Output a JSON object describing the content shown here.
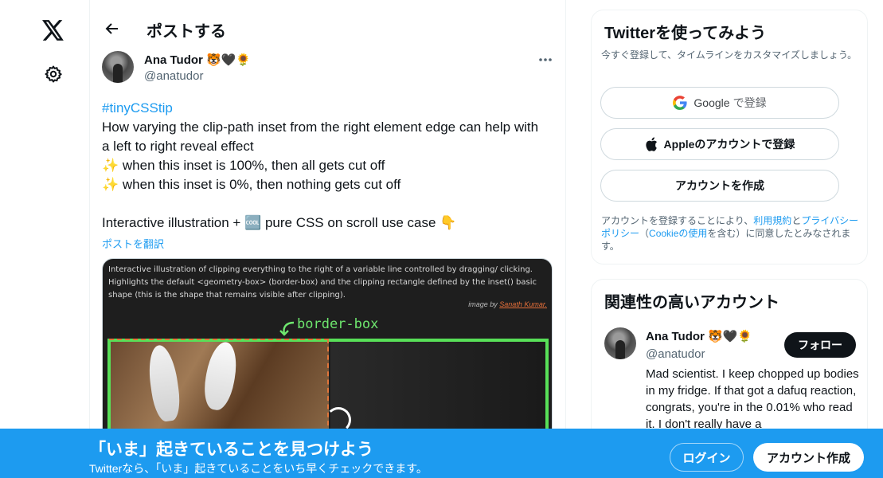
{
  "header": {
    "title": "ポストする"
  },
  "tweet": {
    "author_name": "Ana Tudor 🐯🖤🌻",
    "author_handle": "@anatudor",
    "hashtag": "#tinyCSStip",
    "lines": [
      "How varying the clip-path inset from the right element edge can help with",
      "a left to right reveal effect",
      "✨ when this inset is 100%, then all gets cut off",
      "✨ when this inset is 0%, then nothing gets cut off",
      "",
      "Interactive illustration + 🆒 pure CSS on scroll use case 👇"
    ],
    "translate_link": "ポストを翻訳",
    "media": {
      "caption": "Interactive illustration of clipping everything to the right of a variable line controlled by dragging/ clicking. Highlights the default <geometry-box> (border-box) and the clipping rectangle defined by the inset() basic shape (this is the shape that remains visible after clipping).",
      "credit_prefix": "image by",
      "credit_name": "Sanath Kumar.",
      "label": "border-box"
    }
  },
  "signup_card": {
    "title": "Twitterを使ってみよう",
    "subtitle": "今すぐ登録して、タイムラインをカスタマイズしましょう。",
    "google_label": "Google",
    "google_suffix": "で登録",
    "apple_label": "Appleのアカウントで登録",
    "create_label": "アカウントを作成",
    "terms_prefix": "アカウントを登録することにより、",
    "terms_link1": "利用規約",
    "terms_and": "と",
    "terms_link2": "プライバシーポリシー",
    "terms_paren_open": "（",
    "terms_link3": "Cookieの使用",
    "terms_suffix": "を含む）に同意したとみなされます。"
  },
  "related_card": {
    "title": "関連性の高いアカウント",
    "name": "Ana Tudor 🐯🖤🌻",
    "handle": "@anatudor",
    "follow_label": "フォロー",
    "bio": "Mad scientist. I keep chopped up bodies in my fridge. If that got a dafuq reaction, congrats, you're in the 0.01% who read it. I don't really have a"
  },
  "banner": {
    "title": "「いま」起きていることを見つけよう",
    "subtitle": "Twitterなら、「いま」起きていることをいち早くチェックできます。",
    "login_label": "ログイン",
    "signup_label": "アカウント作成"
  },
  "icons": {
    "logo": "x-logo-icon",
    "settings": "gear-icon",
    "back": "arrow-left-icon",
    "more": "more-horizontal-icon",
    "google": "google-g-icon",
    "apple": "apple-logo-icon"
  },
  "colors": {
    "accent": "#1d9bf0",
    "text": "#0f1419",
    "muted": "#536471",
    "border": "#eff3f4"
  }
}
